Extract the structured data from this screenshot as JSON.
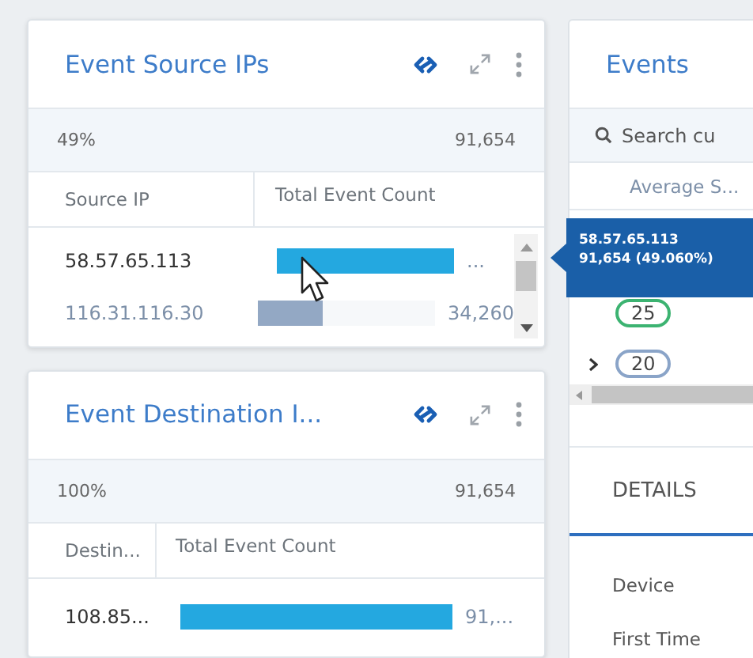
{
  "panels": [
    {
      "title": "Event Source IPs",
      "percent": "49%",
      "total": "91,654",
      "columns": [
        "Source IP",
        "Total Event Count"
      ],
      "scrollbar": true,
      "rows": [
        {
          "label": "58.57.65.113",
          "level": 1.0,
          "value": "...",
          "highlighted": true
        },
        {
          "label": "116.31.116.30",
          "level": 0.37,
          "value": "34,260",
          "highlighted": false
        }
      ]
    },
    {
      "title": "Event Destination I...",
      "percent": "100%",
      "total": "91,654",
      "columns": [
        "Destin...",
        "Total Event Count"
      ],
      "scrollbar": false,
      "rows": [
        {
          "label": "108.85...",
          "level": 1.0,
          "value": "91,...",
          "highlighted": true
        }
      ]
    }
  ],
  "events": {
    "title": "Events",
    "search": {
      "placeholder": "Search cu"
    },
    "column": "Average S...",
    "pills": [
      {
        "label": "25",
        "color": "#3cb371",
        "expander": false
      },
      {
        "label": "20",
        "color": "#8aa4c8",
        "expander": true
      }
    ],
    "details_tab": "DETAILS",
    "fields": [
      "Device",
      "First Time"
    ]
  },
  "tooltip": {
    "lines": [
      "58.57.65.113",
      "91,654 (49.060%)"
    ]
  }
}
